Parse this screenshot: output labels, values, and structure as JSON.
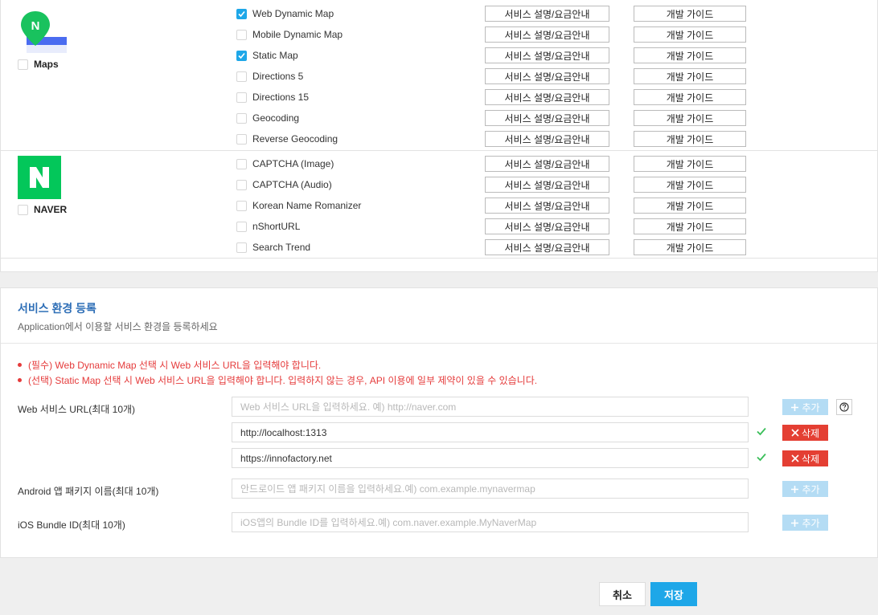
{
  "groups": {
    "maps": {
      "label": "Maps",
      "checked": false,
      "apis": [
        {
          "name": "Web Dynamic Map",
          "checked": true
        },
        {
          "name": "Mobile Dynamic Map",
          "checked": false
        },
        {
          "name": "Static Map",
          "checked": true
        },
        {
          "name": "Directions 5",
          "checked": false
        },
        {
          "name": "Directions 15",
          "checked": false
        },
        {
          "name": "Geocoding",
          "checked": false
        },
        {
          "name": "Reverse Geocoding",
          "checked": false
        }
      ]
    },
    "naver": {
      "label": "NAVER",
      "checked": false,
      "apis": [
        {
          "name": "CAPTCHA (Image)",
          "checked": false
        },
        {
          "name": "CAPTCHA (Audio)",
          "checked": false
        },
        {
          "name": "Korean Name Romanizer",
          "checked": false
        },
        {
          "name": "nShortURL",
          "checked": false
        },
        {
          "name": "Search Trend",
          "checked": false
        }
      ]
    }
  },
  "api_buttons": {
    "description": "서비스 설명/요금안내",
    "guide": "개발 가이드"
  },
  "env": {
    "title": "서비스 환경 등록",
    "subtitle": "Application에서 이용할 서비스 환경을 등록하세요",
    "notices": [
      "(필수) Web Dynamic Map 선택 시 Web 서비스 URL을 입력해야 합니다.",
      "(선택) Static Map 선택 시 Web 서비스 URL을 입력해야 합니다. 입력하지 않는 경우, API 이용에 일부 제약이 있을 수 있습니다."
    ],
    "web": {
      "label": "Web 서비스 URL(최대 10개)",
      "placeholder": "Web 서비스 URL을 입력하세요. 예) http://naver.com",
      "entries": [
        "http://localhost:1313",
        "https://innofactory.net"
      ]
    },
    "android": {
      "label": "Android 앱 패키지 이름(최대 10개)",
      "placeholder": "안드로이드 앱 패키지 이름을 입력하세요.예) com.example.mynavermap"
    },
    "ios": {
      "label": "iOS Bundle ID(최대 10개)",
      "placeholder": "iOS앱의 Bundle ID를 입력하세요.예) com.naver.example.MyNaverMap"
    },
    "add_label": "추가",
    "delete_label": "삭제"
  },
  "footer": {
    "cancel_label": "취소",
    "save_label": "저장"
  },
  "colors": {
    "accent": "#1ea7e8",
    "naver_green": "#03c75a",
    "danger": "#e43f33",
    "add_disabled": "#b4dcf4"
  },
  "icons": {
    "maps_logo": "naver-maps-pin-icon",
    "naver_logo": "naver-n-icon",
    "checkbox_check": "check-icon",
    "add": "plus-icon",
    "delete": "x-icon",
    "valid": "checkmark-icon",
    "help": "question-circle-icon"
  }
}
